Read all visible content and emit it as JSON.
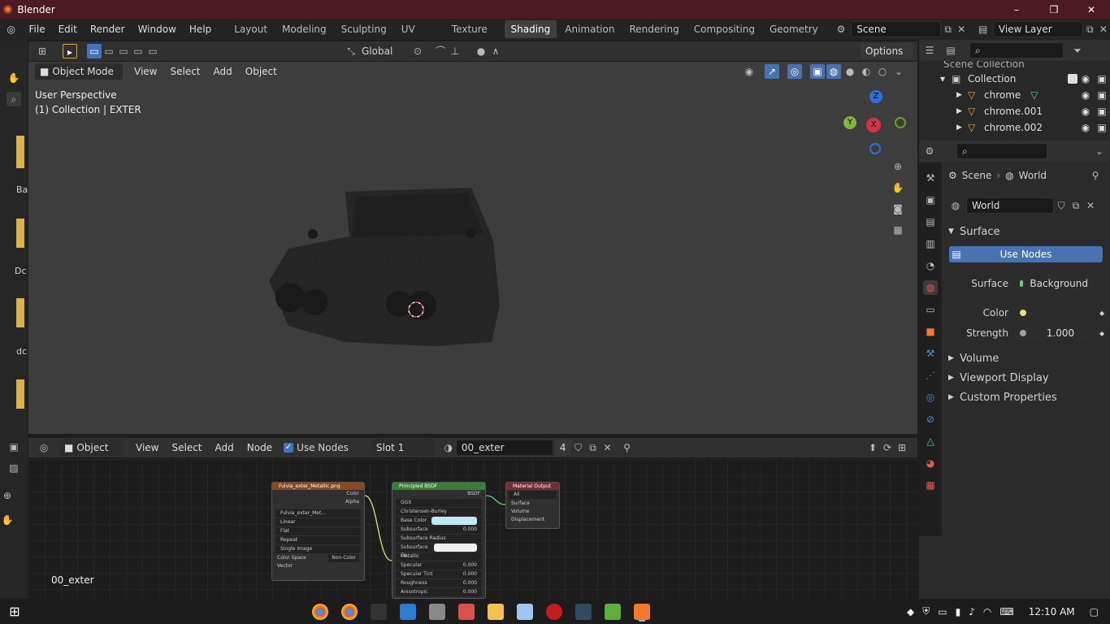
{
  "window": {
    "title": "Blender",
    "controls": [
      "–",
      "❐",
      "✕"
    ]
  },
  "menu": [
    "File",
    "Edit",
    "Render",
    "Window",
    "Help"
  ],
  "workspaces": [
    "Layout",
    "Modeling",
    "Sculpting",
    "UV Editing",
    "Texture Paint",
    "Shading",
    "Animation",
    "Rendering",
    "Compositing",
    "Geometry Nod"
  ],
  "active_workspace": "Shading",
  "scene": {
    "label": "Scene",
    "view_layer": "View Layer"
  },
  "tool_header": {
    "orientation": "Global",
    "options": "Options"
  },
  "viewport": {
    "mode": "Object Mode",
    "menus": [
      "View",
      "Select",
      "Add",
      "Object"
    ],
    "overlay_line1": "User Perspective",
    "overlay_line2": "(1) Collection | EXTER",
    "gizmo_x": "X",
    "gizmo_y": "Y",
    "gizmo_z": "Z"
  },
  "left_shelf": {
    "labels": [
      "Ba",
      "Dc",
      "dc"
    ]
  },
  "outliner": {
    "header": "Scene Collection",
    "collection": "Collection",
    "items": [
      "chrome",
      "chrome.001",
      "chrome.002"
    ]
  },
  "properties": {
    "breadcrumb_scene": "Scene",
    "breadcrumb_world": "World",
    "world_name": "World",
    "surface_panel": "Surface",
    "use_nodes": "Use Nodes",
    "surface_label": "Surface",
    "surface_value": "Background",
    "color_label": "Color",
    "strength_label": "Strength",
    "strength_value": "1.000",
    "panels": [
      "Volume",
      "Viewport Display",
      "Custom Properties"
    ]
  },
  "node_editor": {
    "type": "Object",
    "menus": [
      "View",
      "Select",
      "Add",
      "Node"
    ],
    "use_nodes": "Use Nodes",
    "slot": "Slot 1",
    "material": "00_exter",
    "users": "4",
    "bottom_label": "00_exter",
    "image_node": {
      "title": "Fulvia_exter_Metallic.png",
      "out_color": "Color",
      "out_alpha": "Alpha",
      "image": "Fulvia_exter_Met...",
      "interp": "Linear",
      "proj": "Flat",
      "ext": "Repeat",
      "source": "Single Image",
      "cs_label": "Color Space",
      "cs_value": "Non-Color",
      "vector": "Vector"
    },
    "bsdf_node": {
      "title": "Principled BSDF",
      "out": "BSDF",
      "dist": "GGX",
      "sss": "Christensen-Burley",
      "rows": [
        [
          "Base Color",
          ""
        ],
        [
          "Subsurface",
          "0.000"
        ],
        [
          "Subsurface Radius",
          ""
        ],
        [
          "Subsurface Co",
          ""
        ],
        [
          "Metallic",
          ""
        ],
        [
          "Specular",
          "0.000"
        ],
        [
          "Specular Tint",
          "0.000"
        ],
        [
          "Roughness",
          "0.000"
        ],
        [
          "Anisotropic",
          "0.000"
        ]
      ]
    },
    "output_node": {
      "title": "Material Output",
      "target": "All",
      "inputs": [
        "Surface",
        "Volume",
        "Displacement"
      ]
    }
  },
  "taskbar": {
    "time": "12:10 AM"
  },
  "colors": {
    "titlebar": "#4d1a24",
    "accent": "#4772b3",
    "active_tab": "#3f3f3f"
  }
}
